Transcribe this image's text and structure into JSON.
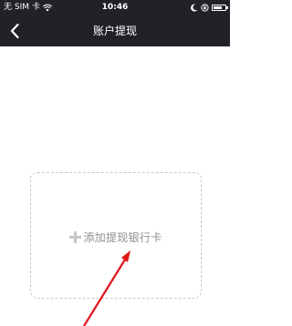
{
  "status_bar": {
    "carrier": "无 SIM 卡",
    "time": "10:46"
  },
  "nav": {
    "title": "账户提现",
    "back_icon": "chevron-left-icon"
  },
  "add_card": {
    "plus_icon": "plus-icon",
    "label": "添加提现银行卡"
  },
  "annotation": {
    "arrow_color": "#e0161b"
  },
  "colors": {
    "nav_background": "#202226",
    "card_border": "#c8c8c8",
    "label_text": "#8e8e8e"
  }
}
